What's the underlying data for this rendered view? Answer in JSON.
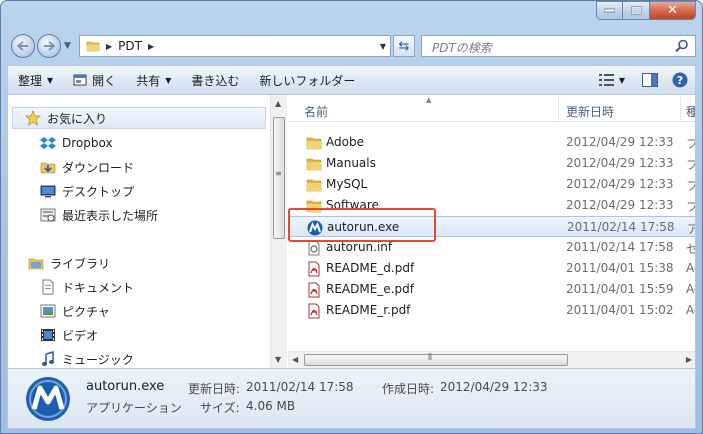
{
  "address": {
    "path": "PDT",
    "search_placeholder": "PDTの検索"
  },
  "toolbar": {
    "organize": "整理",
    "open": "開く",
    "share": "共有",
    "burn": "書き込む",
    "new_folder": "新しいフォルダー"
  },
  "nav": {
    "favorites": "お気に入り",
    "fav_items": [
      "Dropbox",
      "ダウンロード",
      "デスクトップ",
      "最近表示した場所"
    ],
    "library": "ライブラリ",
    "lib_items": [
      "ドキュメント",
      "ピクチャ",
      "ビデオ",
      "ミュージック"
    ]
  },
  "columns": {
    "name": "名前",
    "date": "更新日時",
    "type": "種"
  },
  "files": [
    {
      "name": "Adobe",
      "date": "2012/04/29 12:33",
      "type": "フ",
      "icon": "folder"
    },
    {
      "name": "Manuals",
      "date": "2012/04/29 12:33",
      "type": "フ",
      "icon": "folder"
    },
    {
      "name": "MySQL",
      "date": "2012/04/29 12:33",
      "type": "フ",
      "icon": "folder"
    },
    {
      "name": "Software",
      "date": "2012/04/29 12:33",
      "type": "フ",
      "icon": "folder"
    },
    {
      "name": "autorun.exe",
      "date": "2011/02/14 17:58",
      "type": "ア",
      "icon": "app",
      "selected": true
    },
    {
      "name": "autorun.inf",
      "date": "2011/02/14 17:58",
      "type": "セ",
      "icon": "settings"
    },
    {
      "name": "README_d.pdf",
      "date": "2011/04/01 15:38",
      "type": "Ad",
      "icon": "pdf"
    },
    {
      "name": "README_e.pdf",
      "date": "2011/04/01 15:59",
      "type": "Ad",
      "icon": "pdf"
    },
    {
      "name": "README_r.pdf",
      "date": "2011/04/01 15:02",
      "type": "Ad",
      "icon": "pdf"
    }
  ],
  "details": {
    "file_name": "autorun.exe",
    "modified_label": "更新日時:",
    "modified": "2011/02/14 17:58",
    "created_label": "作成日時:",
    "created": "2012/04/29 12:33",
    "file_type": "アプリケーション",
    "size_label": "サイズ:",
    "size": "4.06 MB"
  },
  "colors": {
    "highlight": "#e8462d",
    "selection": "#d9e8f9",
    "accent": "#2f5f9e"
  }
}
